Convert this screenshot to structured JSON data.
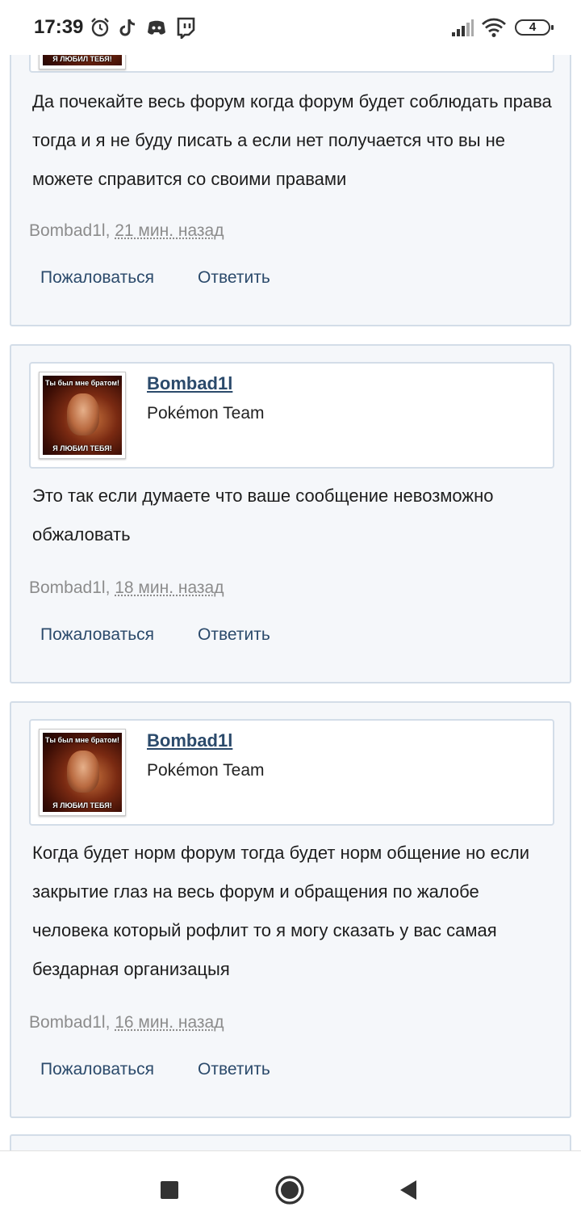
{
  "status_bar": {
    "time": "17:39",
    "battery": "4",
    "icons": [
      "alarm-icon",
      "tiktok-icon",
      "discord-icon",
      "twitch-icon",
      "signal-icon",
      "wifi-icon",
      "battery-icon"
    ]
  },
  "avatar_caption": {
    "top": "Ты был мне братом!",
    "bottom": "Я ЛЮБИЛ ТЕБЯ!"
  },
  "posts": [
    {
      "text": "Да почекайте весь форум когда форум будет соблюдать права тогда и я не буду писать а если нет получается что вы не можете справится со своими правами",
      "author": "Bombad1l",
      "time": "21 мин. назад",
      "report_label": "Пожаловаться",
      "reply_label": "Ответить"
    },
    {
      "username": "Bombad1l",
      "user_title": "Pokémon Team",
      "text": "Это так если думаете что ваше сообщение невозможно обжаловать",
      "author": "Bombad1l",
      "time": "18 мин. назад",
      "report_label": "Пожаловаться",
      "reply_label": "Ответить"
    },
    {
      "username": "Bombad1l",
      "user_title": "Pokémon Team",
      "text": "Когда будет норм форум тогда будет норм общение но если закрытие глаз на весь форум и обращения по жалобе человека который рофлит то я могу сказать у вас самая бездарная организацыя",
      "author": "Bombad1l",
      "time": "16 мин. назад",
      "report_label": "Пожаловаться",
      "reply_label": "Ответить"
    }
  ],
  "colors": {
    "link": "#2b4a6b",
    "post_bg": "#f5f7fa",
    "border": "#d3dde8",
    "meta": "#8c8c8c"
  }
}
